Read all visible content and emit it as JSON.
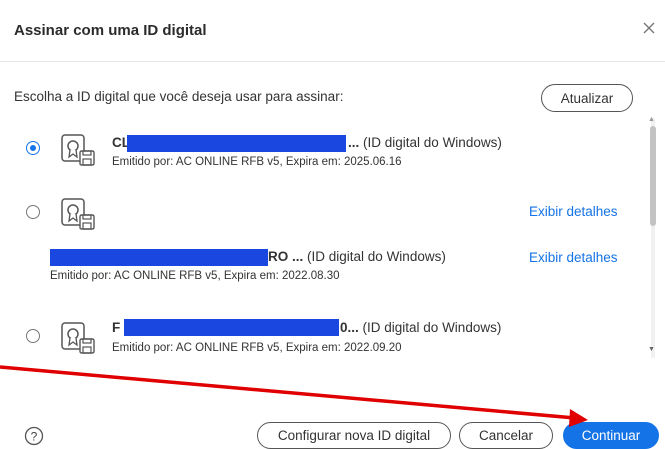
{
  "dialog": {
    "title": "Assinar com uma ID digital",
    "prompt": "Escolha a ID digital que você deseja usar para assinar:",
    "refresh_label": "Atualizar"
  },
  "certificates": [
    {
      "selected": true,
      "name_prefix": "CL",
      "name_suffix": "...",
      "type": "(ID digital do Windows)",
      "issuer": "Emitido por: AC ONLINE RFB v5, Expira em: 2025.06.16"
    },
    {
      "selected": false,
      "details_link": "Exibir detalhes"
    },
    {
      "name_suffix": "RO ...",
      "type": "(ID digital do Windows)",
      "issuer": "Emitido por: AC ONLINE RFB v5, Expira em: 2022.08.30",
      "details_link": "Exibir detalhes"
    },
    {
      "selected": false,
      "name_prefix": "F",
      "name_suffix": "0...",
      "type": "(ID digital do Windows)",
      "issuer": "Emitido por: AC ONLINE RFB v5, Expira em: 2022.09.20"
    }
  ],
  "footer": {
    "help_icon": "?",
    "new_id_label": "Configurar nova ID digital",
    "cancel_label": "Cancelar",
    "continue_label": "Continuar"
  },
  "colors": {
    "accent": "#1473e6",
    "redaction": "#1a47e0",
    "annotation_arrow": "#e00000"
  },
  "icons": [
    "close-icon",
    "certificate-icon",
    "help-icon",
    "scroll-up-icon",
    "scroll-down-icon",
    "annotation-arrow"
  ]
}
